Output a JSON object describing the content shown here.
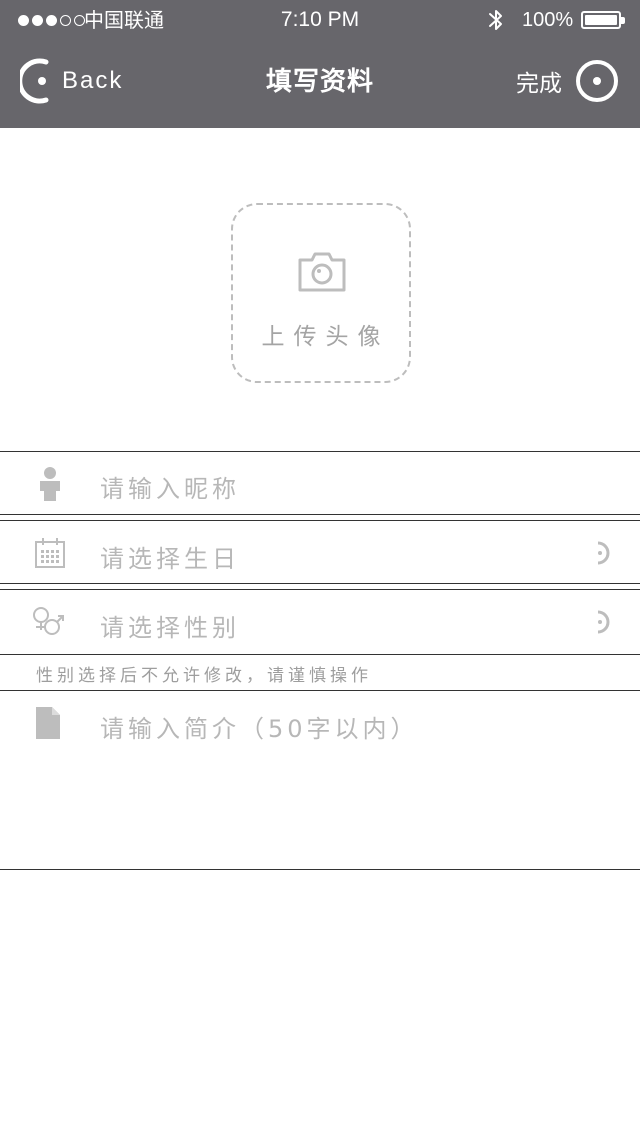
{
  "status_bar": {
    "carrier": "中国联通",
    "time": "7:10 PM",
    "battery": "100%",
    "signal_bars": 3
  },
  "nav": {
    "back_label": "Back",
    "title": "填写资料",
    "done_label": "完成"
  },
  "avatar": {
    "upload_label": "上传头像"
  },
  "form": {
    "nickname_placeholder": "请输入昵称",
    "birthday_placeholder": "请选择生日",
    "gender_placeholder": "请选择性别",
    "gender_note": "性别选择后不允许修改，请谨慎操作",
    "bio_placeholder": "请输入简介（50字以内）"
  },
  "icons": {
    "back": "back-circle-icon",
    "done": "done-circle-icon",
    "camera": "camera-icon",
    "person": "person-icon",
    "calendar": "calendar-icon",
    "gender": "gender-icon",
    "document": "document-icon",
    "chevron": "chevron-right-icon"
  },
  "colors": {
    "header_bg": "#67666b",
    "placeholder_text": "#b7b7b7",
    "note_text": "#9e9e9e",
    "icon_gray": "#bdbdbd",
    "divider": "#333333"
  }
}
